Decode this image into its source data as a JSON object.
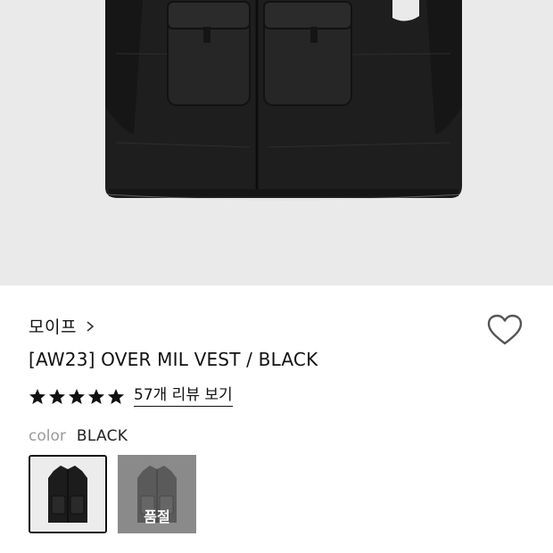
{
  "product": {
    "brand": "모이프",
    "title": "[AW23] OVER MIL VEST / BLACK",
    "rating_stars": 5,
    "review_link": "57개 리뷰 보기",
    "color_label": "color",
    "color_value": "BLACK",
    "options": [
      {
        "name": "BLACK",
        "selected": true
      },
      {
        "name": "",
        "status": "품절"
      }
    ]
  },
  "icons": [
    "chevron-right-icon",
    "heart-icon",
    "star-icon"
  ]
}
